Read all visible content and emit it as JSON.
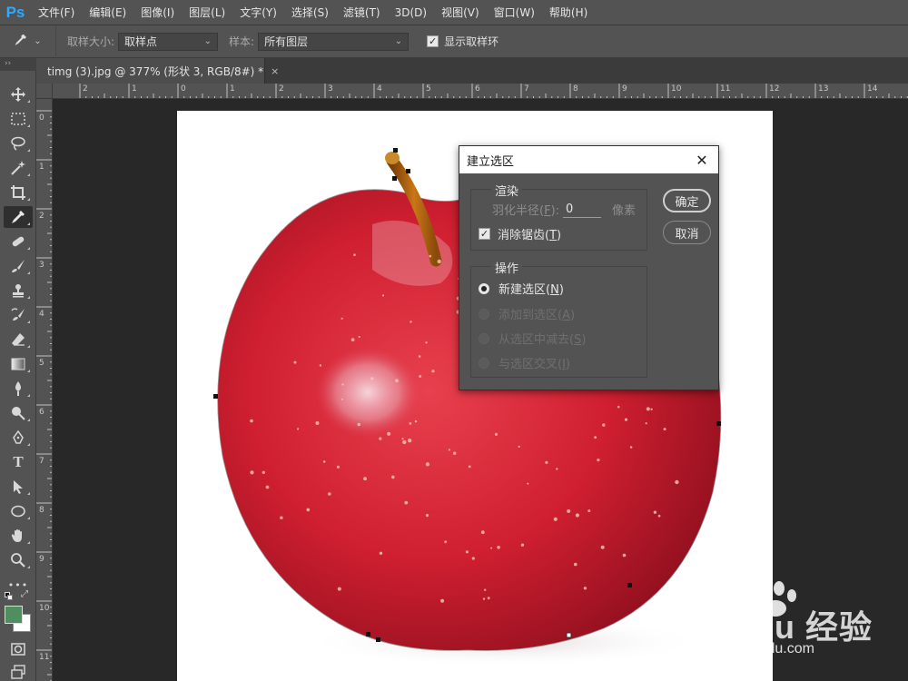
{
  "app": {
    "logo": "Ps",
    "menu": [
      "文件(F)",
      "编辑(E)",
      "图像(I)",
      "图层(L)",
      "文字(Y)",
      "选择(S)",
      "滤镜(T)",
      "3D(D)",
      "视图(V)",
      "窗口(W)",
      "帮助(H)"
    ]
  },
  "options": {
    "sample_size_label": "取样大小:",
    "sample_size_value": "取样点",
    "sample_label": "样本:",
    "sample_value": "所有图层",
    "show_ring_label": "显示取样环",
    "show_ring_checked": true
  },
  "panel_toggle": "››",
  "document": {
    "tab_title": "timg (3).jpg @ 377% (形状 3, RGB/8#) *",
    "close_glyph": "×"
  },
  "rulers": {
    "horizontal": [
      "2",
      "1",
      "0",
      "1",
      "2",
      "3",
      "4",
      "5",
      "6",
      "7",
      "8",
      "9",
      "10",
      "11",
      "12",
      "13",
      "14"
    ],
    "vertical": [
      "0",
      "1",
      "2",
      "3",
      "4",
      "5",
      "6",
      "7",
      "8",
      "9",
      "10",
      "11"
    ]
  },
  "tools": [
    {
      "icon": "move-tool-icon"
    },
    {
      "icon": "marquee-tool-icon"
    },
    {
      "icon": "lasso-tool-icon"
    },
    {
      "icon": "magic-wand-tool-icon"
    },
    {
      "icon": "crop-tool-icon"
    },
    {
      "icon": "eyedropper-tool-icon",
      "active": true
    },
    {
      "icon": "healing-brush-tool-icon"
    },
    {
      "icon": "brush-tool-icon"
    },
    {
      "icon": "clone-stamp-tool-icon"
    },
    {
      "icon": "history-brush-tool-icon"
    },
    {
      "icon": "eraser-tool-icon"
    },
    {
      "icon": "gradient-tool-icon"
    },
    {
      "icon": "blur-tool-icon"
    },
    {
      "icon": "dodge-tool-icon"
    },
    {
      "icon": "pen-tool-icon"
    },
    {
      "icon": "type-tool-icon",
      "glyph": "T"
    },
    {
      "icon": "path-selection-tool-icon"
    },
    {
      "icon": "ellipse-tool-icon"
    },
    {
      "icon": "hand-tool-icon"
    },
    {
      "icon": "zoom-tool-icon"
    },
    {
      "icon": "more-tools-icon",
      "glyph": "•••"
    }
  ],
  "colors": {
    "foreground": "#4f8f5f",
    "background": "#ffffff"
  },
  "dialog": {
    "title": "建立选区",
    "close_glyph": "✕",
    "render_group": "渲染",
    "feather_label_pre": "羽化半径(",
    "feather_key": "F",
    "feather_label_post": "):",
    "feather_value": "0",
    "feather_unit": "像素",
    "antialias_pre": "消除锯齿(",
    "antialias_key": "T",
    "antialias_post": ")",
    "antialias_checked": true,
    "operation_group": "操作",
    "ops": [
      {
        "pre": "新建选区(",
        "key": "N",
        "post": ")",
        "selected": true,
        "enabled": true
      },
      {
        "pre": "添加到选区(",
        "key": "A",
        "post": ")",
        "selected": false,
        "enabled": false
      },
      {
        "pre": "从选区中减去(",
        "key": "S",
        "post": ")",
        "selected": false,
        "enabled": false
      },
      {
        "pre": "与选区交叉(",
        "key": "I",
        "post": ")",
        "selected": false,
        "enabled": false
      }
    ],
    "ok": "确定",
    "cancel": "取消"
  },
  "watermark": {
    "brand": "Bai du 经验",
    "url": "jingyan.baidu.com"
  }
}
